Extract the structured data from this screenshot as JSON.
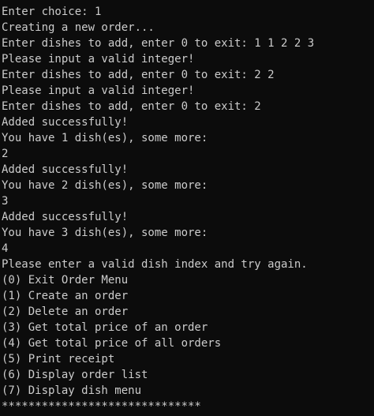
{
  "colors": {
    "background": "#0c0c0c",
    "text": "#cccccc"
  },
  "console": {
    "lines": [
      "Enter choice: 1",
      "Creating a new order...",
      "Enter dishes to add, enter 0 to exit: 1 1 2 2 3",
      "Please input a valid integer!",
      "Enter dishes to add, enter 0 to exit: 2 2",
      "Please input a valid integer!",
      "Enter dishes to add, enter 0 to exit: 2",
      "Added successfully!",
      "You have 1 dish(es), some more:",
      "2",
      "Added successfully!",
      "You have 2 dish(es), some more:",
      "3",
      "Added successfully!",
      "You have 3 dish(es), some more:",
      "4",
      "Please enter a valid dish index and try again.",
      "(0) Exit Order Menu",
      "(1) Create an order",
      "(2) Delete an order",
      "(3) Get total price of an order",
      "(4) Get total price of all orders",
      "(5) Print receipt",
      "(6) Display order list",
      "(7) Display dish menu",
      "******************************"
    ]
  }
}
